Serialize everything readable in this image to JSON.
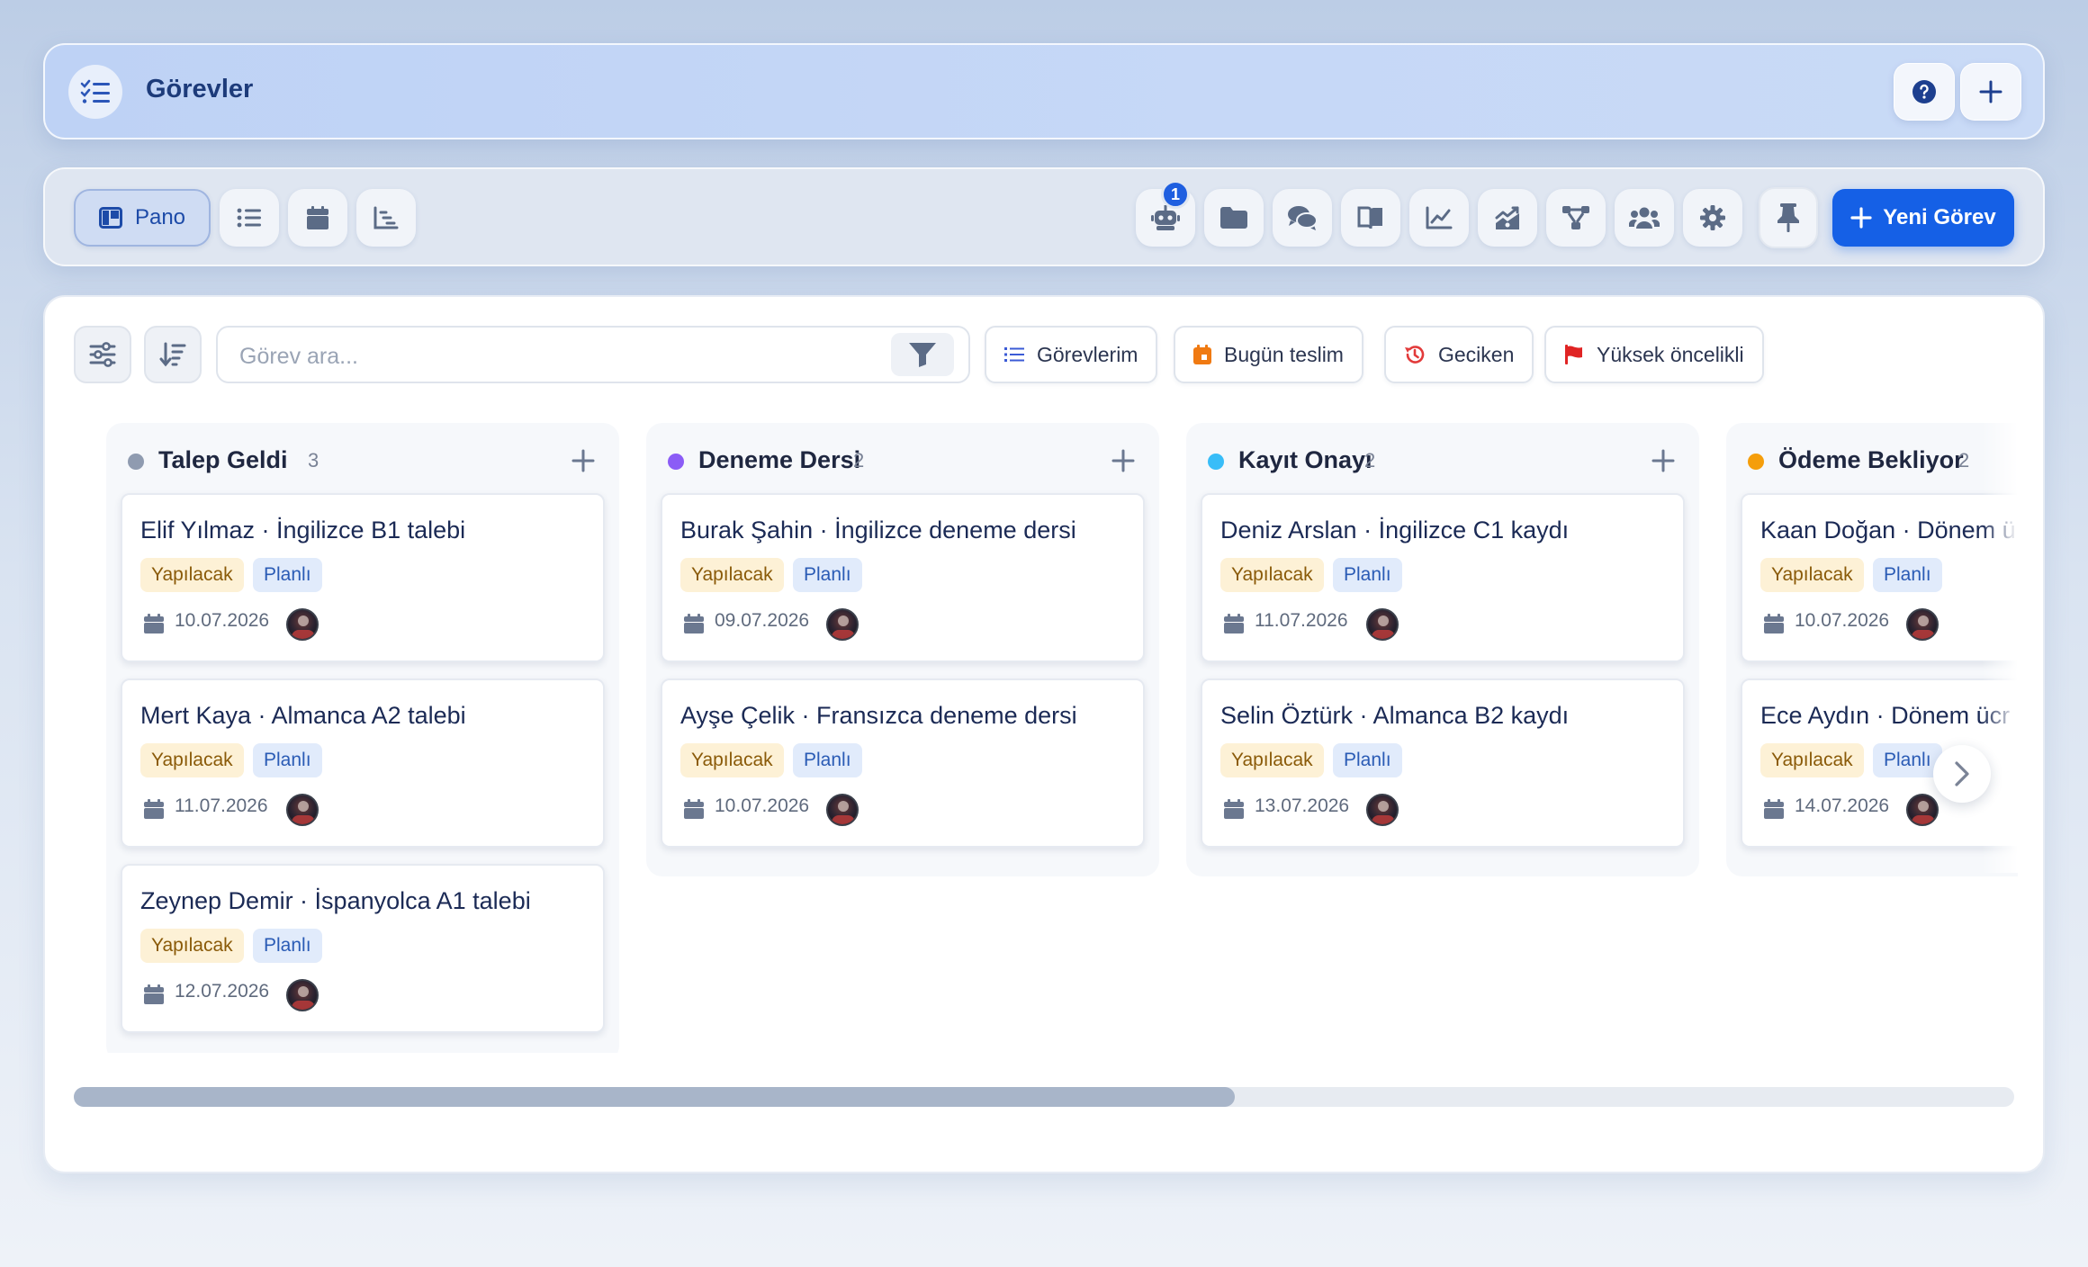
{
  "header": {
    "title": "Görevler",
    "icon": "task-list-icon",
    "help_icon": "help-circle-icon",
    "add_icon": "plus-icon"
  },
  "toolbar": {
    "views": [
      {
        "name": "board",
        "label": "Pano",
        "icon": "kanban-icon",
        "active": true
      },
      {
        "name": "list",
        "icon": "list-icon"
      },
      {
        "name": "calendar",
        "icon": "calendar-icon"
      },
      {
        "name": "gantt",
        "icon": "gantt-icon"
      }
    ],
    "tools": [
      {
        "name": "automation",
        "icon": "robot-icon",
        "badge": "1"
      },
      {
        "name": "files",
        "icon": "folder-icon"
      },
      {
        "name": "comments",
        "icon": "chat-icon"
      },
      {
        "name": "docs",
        "icon": "book-icon"
      },
      {
        "name": "reports",
        "icon": "line-chart-icon"
      },
      {
        "name": "analytics",
        "icon": "area-chart-icon"
      },
      {
        "name": "workflow",
        "icon": "flow-icon"
      },
      {
        "name": "team",
        "icon": "users-icon"
      },
      {
        "name": "settings",
        "icon": "gear-icon"
      },
      {
        "name": "pin",
        "icon": "pin-icon"
      }
    ],
    "new_task_label": "Yeni Görev"
  },
  "filters": {
    "search_placeholder": "Görev ara...",
    "chips": [
      {
        "label": "Görevlerim",
        "icon": "task-list-icon",
        "color": "#3b5bd6"
      },
      {
        "label": "Bugün teslim",
        "icon": "calendar-today-icon",
        "color": "#f07a12"
      },
      {
        "label": "Geciken",
        "icon": "history-icon",
        "color": "#e23a3a"
      },
      {
        "label": "Yüksek öncelikli",
        "icon": "flag-icon",
        "color": "#e02424"
      }
    ]
  },
  "board": {
    "columns": [
      {
        "title": "Talep Geldi",
        "count": "3",
        "color": "#8f9bb0",
        "cards": [
          {
            "title": "Elif Yılmaz · İngilizce B1 talebi",
            "status": "Yapılacak",
            "type": "Planlı",
            "date": "10.07.2026"
          },
          {
            "title": "Mert Kaya · Almanca A2 talebi",
            "status": "Yapılacak",
            "type": "Planlı",
            "date": "11.07.2026"
          },
          {
            "title": "Zeynep Demir · İspanyolca A1 talebi",
            "status": "Yapılacak",
            "type": "Planlı",
            "date": "12.07.2026"
          }
        ]
      },
      {
        "title": "Deneme Dersi",
        "count": "2",
        "color": "#8b5cf6",
        "cards": [
          {
            "title": "Burak Şahin · İngilizce deneme dersi",
            "status": "Yapılacak",
            "type": "Planlı",
            "date": "09.07.2026"
          },
          {
            "title": "Ayşe Çelik · Fransızca deneme dersi",
            "status": "Yapılacak",
            "type": "Planlı",
            "date": "10.07.2026"
          }
        ]
      },
      {
        "title": "Kayıt Onayı",
        "count": "2",
        "color": "#38bdf8",
        "cards": [
          {
            "title": "Deniz Arslan · İngilizce C1 kaydı",
            "status": "Yapılacak",
            "type": "Planlı",
            "date": "11.07.2026"
          },
          {
            "title": "Selin Öztürk · Almanca B2 kaydı",
            "status": "Yapılacak",
            "type": "Planlı",
            "date": "13.07.2026"
          }
        ]
      },
      {
        "title": "Ödeme Bekliyor",
        "count": "2",
        "color": "#f59e0b",
        "cards": [
          {
            "title": "Kaan Doğan · Dönem ü",
            "status": "Yapılacak",
            "type": "Planlı",
            "date": "10.07.2026"
          },
          {
            "title": "Ece Aydın · Dönem ücr",
            "status": "Yapılacak",
            "type": "Planlı",
            "date": "14.07.2026"
          }
        ]
      }
    ],
    "scroll_position": 0.6
  }
}
